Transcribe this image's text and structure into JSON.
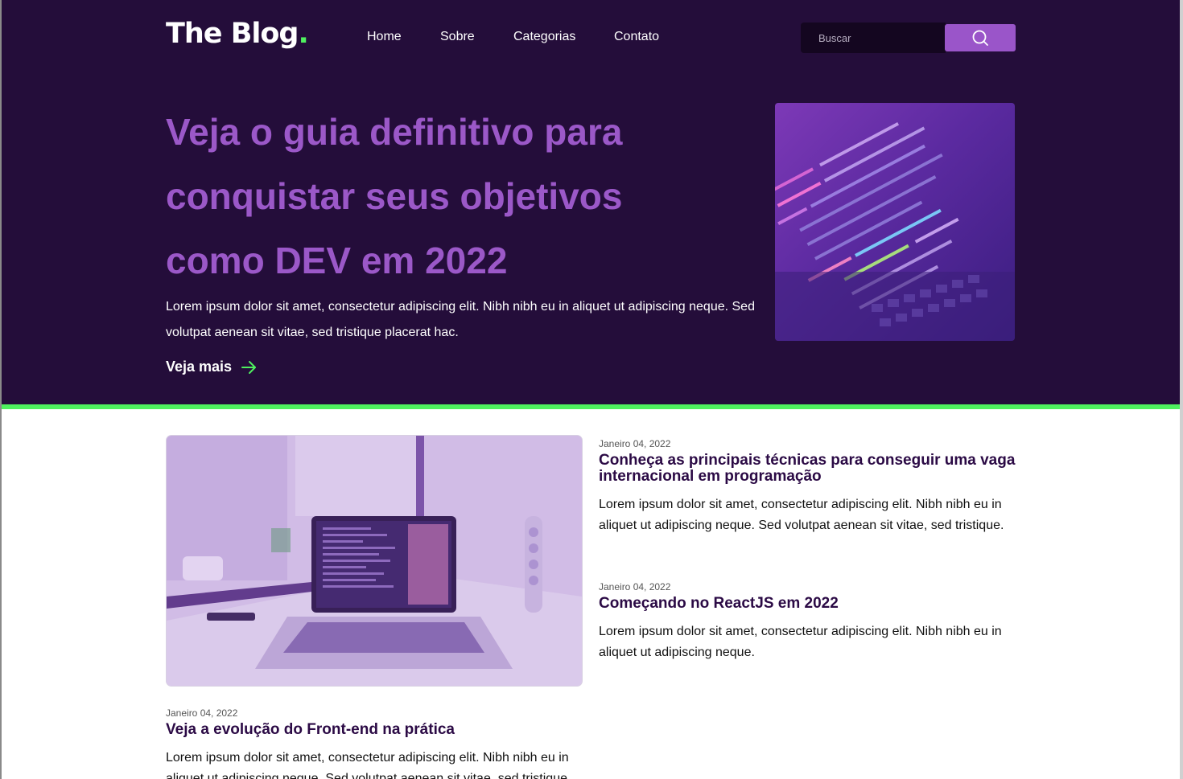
{
  "header": {
    "logo_text": "The Blog",
    "logo_dot": ".",
    "nav": [
      "Home",
      "Sobre",
      "Categorias",
      "Contato"
    ],
    "search_placeholder": "Buscar",
    "search_icon": "search-icon"
  },
  "hero": {
    "title": "Veja o guia definitivo para conquistar seus objetivos como DEV em 2022",
    "text": "Lorem ipsum dolor sit amet, consectetur adipiscing elit. Nibh nibh eu in aliquet ut adipiscing neque. Sed volutpat aenean sit vitae, sed tristique placerat hac.",
    "more_label": "Veja mais",
    "more_icon": "arrow-right-icon",
    "image_alt": "code-on-laptop-image"
  },
  "posts": [
    {
      "date": "Janeiro 04, 2022",
      "title": "Conheça as principais técnicas para conseguir uma vaga internacional em programação",
      "excerpt": "Lorem ipsum dolor sit amet, consectetur adipiscing elit. Nibh nibh eu in aliquet ut adipiscing neque. Sed volutpat aenean sit vitae, sed tristique."
    },
    {
      "date": "Janeiro 04, 2022",
      "title": "Começando no ReactJS em 2022",
      "excerpt": "Lorem ipsum dolor sit amet, consectetur adipiscing elit. Nibh nibh eu in aliquet ut adipiscing neque."
    },
    {
      "date": "Janeiro 04, 2022",
      "title": "Veja a evolução do Front-end na prática",
      "excerpt": "Lorem ipsum dolor sit amet, consectetur adipiscing elit. Nibh nibh eu in aliquet ut adipiscing neque. Sed volutpat aenean sit vitae, sed tristique."
    }
  ],
  "colors": {
    "hero_bg": "#240d3a",
    "accent_purple": "#9b58c8",
    "accent_green": "#4ff05f",
    "post_title": "#2b0a45"
  }
}
